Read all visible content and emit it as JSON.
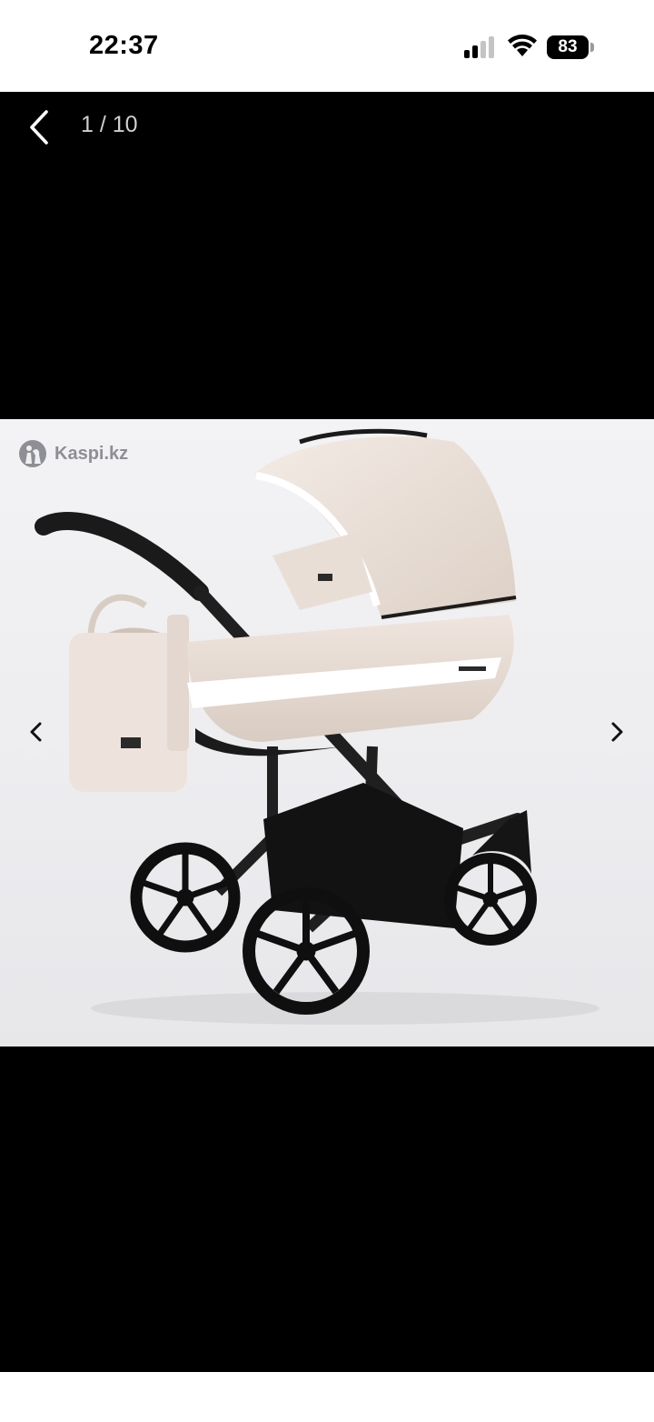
{
  "status_bar": {
    "time": "22:37",
    "battery_level": "83",
    "icons": [
      "signal-icon",
      "wifi-icon",
      "battery-icon"
    ]
  },
  "viewer": {
    "counter": "1 / 10",
    "current_index": 1,
    "total_images": 10,
    "back_icon": "chevron-left-icon",
    "prev_icon": "chevron-left-icon",
    "next_icon": "chevron-right-icon"
  },
  "photo": {
    "watermark": "Kaspi.kz",
    "watermark_icon": "kaspi-logo-icon"
  },
  "colors": {
    "viewer_background": "#000000",
    "status_bar_background": "#ffffff",
    "counter_text": "#cfcfcf"
  }
}
